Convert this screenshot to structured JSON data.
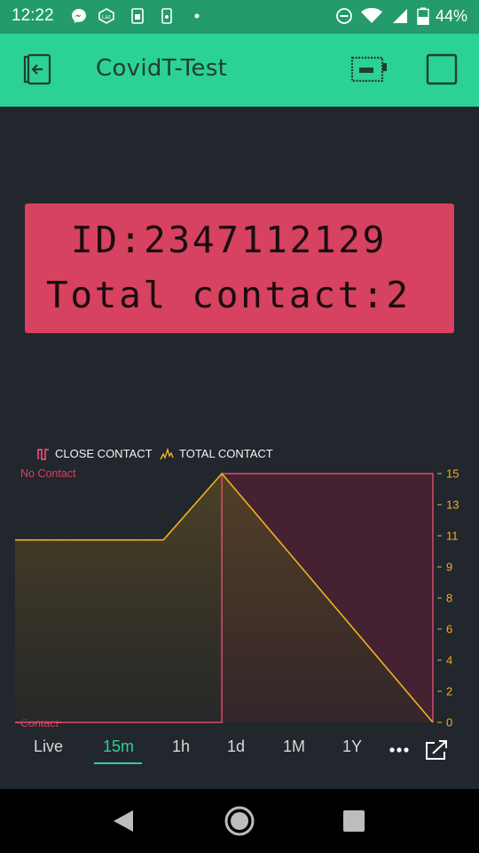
{
  "status_bar": {
    "time": "12:22",
    "battery_percent": "44%",
    "icons": [
      "messenger-icon",
      "lazada-icon",
      "sim-icon",
      "phone-icon",
      "dot-icon",
      "dnd-icon",
      "wifi-icon",
      "signal-icon",
      "battery-icon"
    ]
  },
  "app_bar": {
    "title": "CovidT-Test",
    "icons": [
      "exit-icon",
      "device-battery-icon",
      "stop-square-icon"
    ]
  },
  "lcd": {
    "line1": "ID:2347112129",
    "line2": "Total contact:2",
    "background": "#d6425f"
  },
  "legend": {
    "close_contact": "CLOSE CONTACT",
    "total_contact": "TOTAL CONTACT"
  },
  "chart_data": {
    "type": "line",
    "series": [
      {
        "name": "CLOSE CONTACT",
        "color": "#ff5577",
        "style": "step",
        "points": [
          [
            0,
            0
          ],
          [
            0.495,
            0
          ],
          [
            0.495,
            1
          ],
          [
            1,
            1
          ]
        ]
      },
      {
        "name": "TOTAL CONTACT",
        "color": "#f0b020",
        "points": [
          [
            0,
            11
          ],
          [
            0.355,
            11
          ],
          [
            0.495,
            15
          ],
          [
            1,
            0
          ]
        ]
      }
    ],
    "left_axis": {
      "top_label": "No Contact",
      "bottom_label": "Contact"
    },
    "right_axis": {
      "ticks": [
        "15",
        "13",
        "11",
        "9",
        "8",
        "6",
        "4",
        "2",
        "0"
      ],
      "ylim": [
        0,
        15
      ]
    }
  },
  "tabs": {
    "items": [
      "Live",
      "15m",
      "1h",
      "1d",
      "1M",
      "1Y"
    ],
    "active": "15m"
  },
  "nav": {
    "icons": [
      "back-icon",
      "home-icon",
      "recents-icon"
    ]
  }
}
